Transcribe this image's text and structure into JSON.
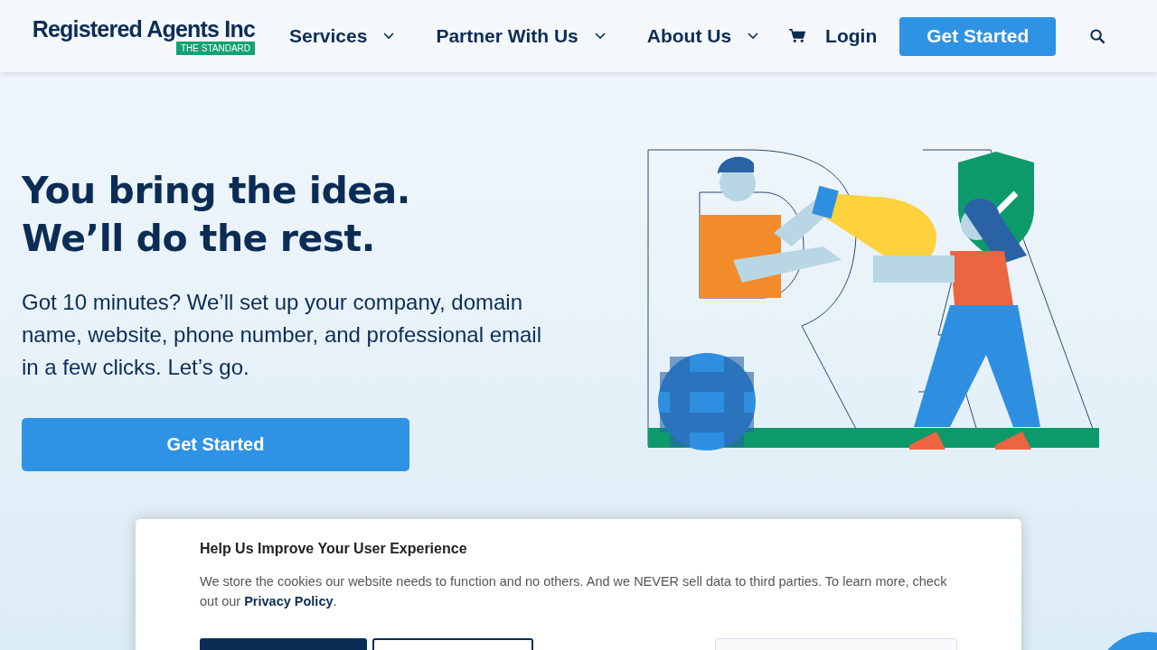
{
  "header": {
    "logo": {
      "name": "Registered Agents Inc",
      "tagline": "THE STANDARD"
    },
    "nav": [
      {
        "label": "Services",
        "has_menu": true
      },
      {
        "label": "Partner With Us",
        "has_menu": true
      },
      {
        "label": "About Us",
        "has_menu": true
      }
    ],
    "login": "Login",
    "cta": "Get Started"
  },
  "hero": {
    "headline": [
      "You bring the idea.",
      "We’ll do the rest."
    ],
    "text": "Got 10 minutes? We’ll set up your company, domain name, website, phone number, and professional email in a few clicks. Let’s go.",
    "button": "Get Started"
  },
  "cookie_banner": {
    "title": "Help Us Improve Your User Experience",
    "text": "We store the cookies our website needs to function and no others. And we NEVER sell data to third parties. To learn more, check out our ",
    "link": "Privacy Policy",
    "after": "."
  }
}
